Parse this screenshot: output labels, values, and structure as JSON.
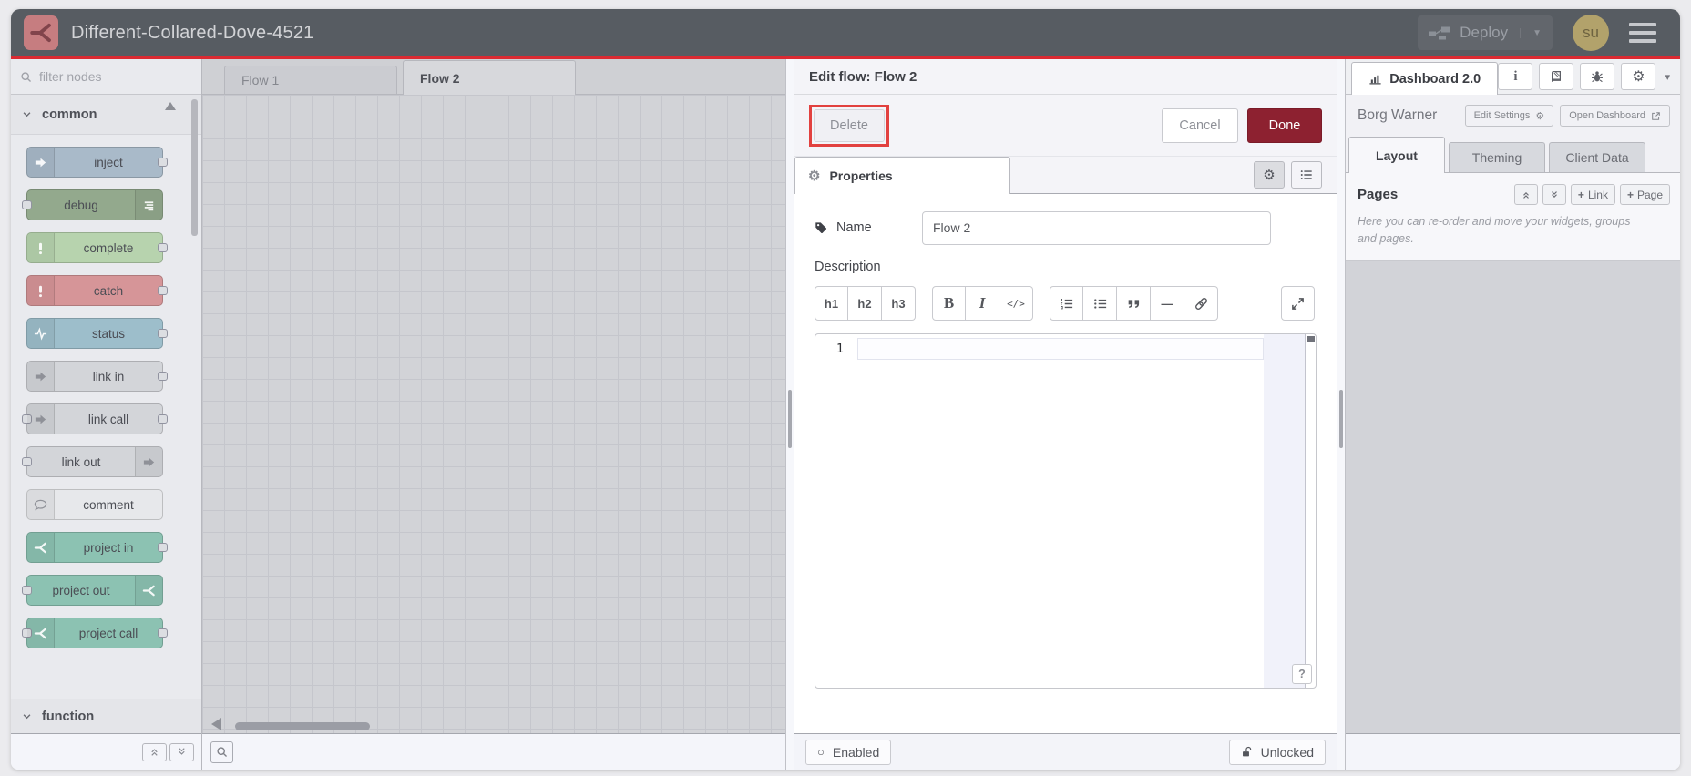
{
  "header": {
    "title": "Different-Collared-Dove-4521",
    "deploy_label": "Deploy",
    "avatar_initials": "su"
  },
  "palette": {
    "search_placeholder": "filter nodes",
    "categories": {
      "common": "common",
      "function": "function"
    },
    "nodes": [
      {
        "label": "inject"
      },
      {
        "label": "debug"
      },
      {
        "label": "complete"
      },
      {
        "label": "catch"
      },
      {
        "label": "status"
      },
      {
        "label": "link in"
      },
      {
        "label": "link call"
      },
      {
        "label": "link out"
      },
      {
        "label": "comment"
      },
      {
        "label": "project in"
      },
      {
        "label": "project out"
      },
      {
        "label": "project call"
      }
    ]
  },
  "workspace": {
    "tabs": [
      {
        "label": "Flow 1"
      },
      {
        "label": "Flow 2"
      }
    ]
  },
  "dialog": {
    "title": "Edit flow: Flow 2",
    "delete_label": "Delete",
    "cancel_label": "Cancel",
    "done_label": "Done",
    "properties_tab": "Properties",
    "name_label": "Name",
    "name_value": "Flow 2",
    "description_label": "Description",
    "md_toolbar": {
      "h1": "h1",
      "h2": "h2",
      "h3": "h3",
      "bold": "B",
      "italic": "I",
      "code": "</>"
    },
    "editor": {
      "line_number": "1",
      "help_label": "?"
    },
    "footer": {
      "enabled_label": "Enabled",
      "unlocked_label": "Unlocked"
    }
  },
  "sidebar": {
    "dashboard_tab": "Dashboard 2.0",
    "project_name": "Borg Warner",
    "edit_settings_label": "Edit Settings",
    "open_dashboard_label": "Open Dashboard",
    "tabs": [
      {
        "label": "Layout"
      },
      {
        "label": "Theming"
      },
      {
        "label": "Client Data"
      }
    ],
    "pages": {
      "title": "Pages",
      "plus": "+",
      "link_label": "Link",
      "page_label": "Page",
      "hint": "Here you can re-order and move your widgets, groups and pages."
    }
  },
  "colors": {
    "header_bg": "#575c62",
    "accent_red_line": "#db2a32",
    "logo_bg": "#c67d80",
    "avatar_bg": "#b2a26b",
    "done_button": "#8d2130",
    "delete_annotation": "#e2413f",
    "node_inject": "#a9bac9",
    "node_debug": "#93a98d",
    "node_complete": "#b7d3ae",
    "node_catch": "#d69598",
    "node_status": "#9dbecb",
    "node_link": "#d3d5d9",
    "node_comment": "#e7e8eb",
    "node_project": "#8cc2b2"
  }
}
